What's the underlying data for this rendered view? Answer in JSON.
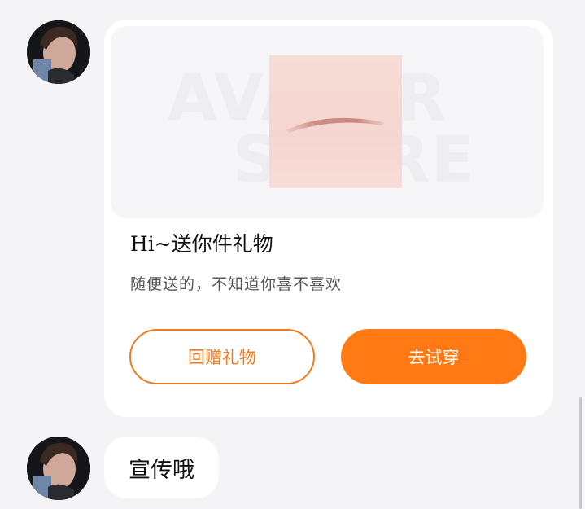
{
  "messages": [
    {
      "type": "gift-card",
      "card": {
        "watermark_line1": "AVATAR",
        "watermark_line2": "STORE",
        "item_icon": "eyebrow-swatch",
        "title": "Hi~送你件礼物",
        "subtitle": "随便送的，不知道你喜不喜欢",
        "return_gift_label": "回赠礼物",
        "try_on_label": "去试穿"
      }
    },
    {
      "type": "text",
      "text": "宣传哦"
    }
  ],
  "colors": {
    "accent": "#ff7a15",
    "accent_outline": "#f07a1e",
    "background": "#f4f4f6",
    "card": "#ffffff"
  }
}
